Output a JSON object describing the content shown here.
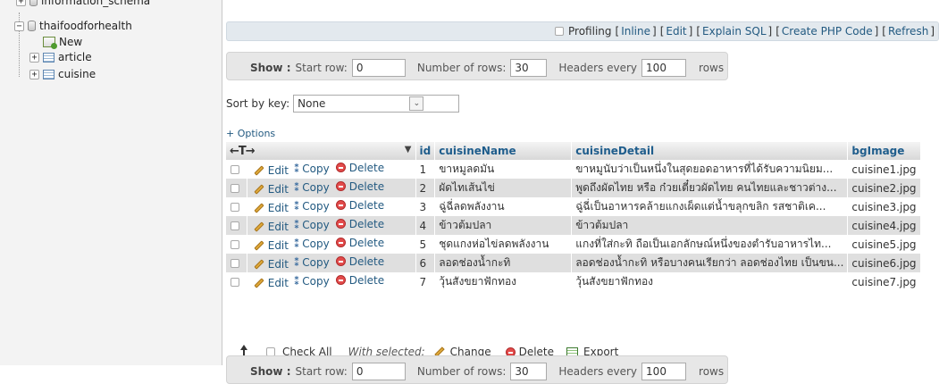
{
  "tree": {
    "partial_db": "information_schema",
    "db": "thaifoodforhealth",
    "children": [
      "New",
      "article",
      "cuisine"
    ]
  },
  "profiling": {
    "label": "Profiling",
    "links": [
      "Inline",
      "Edit",
      "Explain SQL",
      "Create PHP Code",
      "Refresh"
    ]
  },
  "nav": {
    "show_label": "Show :",
    "start_row_label": "Start row:",
    "start_row_value": "0",
    "rows_label": "Number of rows:",
    "rows_value": "30",
    "headers_label": "Headers every",
    "headers_value": "100",
    "rows_suffix": "rows"
  },
  "sort": {
    "label": "Sort by key:",
    "value": "None"
  },
  "options_label": "+ Options",
  "table": {
    "arrows": "←T→",
    "columns": [
      "id",
      "cuisineName",
      "cuisineDetail",
      "bgImage"
    ],
    "actions": {
      "edit": "Edit",
      "copy": "Copy",
      "delete": "Delete"
    },
    "rows": [
      {
        "id": "1",
        "name": "ขาหมูลดมัน",
        "detail": "ขาหมูนับว่าเป็นหนึ่งในสุดยอดอาหารที่ได้รับความนิยม...",
        "img": "cuisine1.jpg"
      },
      {
        "id": "2",
        "name": "ผัดไทเส้นไข่",
        "detail": "พูดถึงผัดไทย หรือ ก๋วยเตี๋ยวผัดไทย คนไทยและชาวต่าง...",
        "img": "cuisine2.jpg"
      },
      {
        "id": "3",
        "name": "ฉู่ฉี่ลดพลังงาน",
        "detail": "ฉู่ฉี่เป็นอาหารคล้ายแกงเผ็ดแต่น้ำขลุกขลิก รสชาติเค...",
        "img": "cuisine3.jpg"
      },
      {
        "id": "4",
        "name": "ข้าวต้มปลา",
        "detail": "ข้าวต้มปลา",
        "img": "cuisine4.jpg"
      },
      {
        "id": "5",
        "name": "ชุดแกงห่อไข่ลดพลังงาน",
        "detail": "แกงที่ใส่กะทิ ถือเป็นเอกลักษณ์หนึ่งของตำรับอาหารไท...",
        "img": "cuisine5.jpg"
      },
      {
        "id": "6",
        "name": "ลอดช่องน้ำกะทิ",
        "detail": "ลอดช่องน้ำกะทิ หรือบางคนเรียกว่า ลอดช่องไทย เป็นขน...",
        "img": "cuisine6.jpg"
      },
      {
        "id": "7",
        "name": "วุ้นสังขยาฟักทอง",
        "detail": "วุ้นสังขยาฟักทอง",
        "img": "cuisine7.jpg"
      }
    ]
  },
  "footer": {
    "check_all": "Check All",
    "with_selected": "With selected:",
    "change": "Change",
    "delete": "Delete",
    "export": "Export"
  },
  "colors": {
    "link": "#235a81",
    "row_alt": "#dfdfdf",
    "delete_icon": "#e34b4b"
  }
}
